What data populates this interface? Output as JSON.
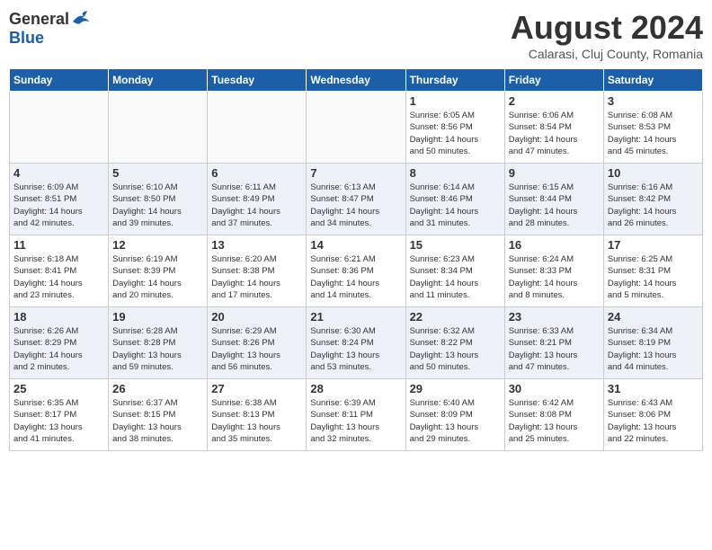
{
  "header": {
    "logo_general": "General",
    "logo_blue": "Blue",
    "month_title": "August 2024",
    "location": "Calarasi, Cluj County, Romania"
  },
  "weekdays": [
    "Sunday",
    "Monday",
    "Tuesday",
    "Wednesday",
    "Thursday",
    "Friday",
    "Saturday"
  ],
  "weeks": [
    [
      {
        "day": "",
        "info": ""
      },
      {
        "day": "",
        "info": ""
      },
      {
        "day": "",
        "info": ""
      },
      {
        "day": "",
        "info": ""
      },
      {
        "day": "1",
        "info": "Sunrise: 6:05 AM\nSunset: 8:56 PM\nDaylight: 14 hours\nand 50 minutes."
      },
      {
        "day": "2",
        "info": "Sunrise: 6:06 AM\nSunset: 8:54 PM\nDaylight: 14 hours\nand 47 minutes."
      },
      {
        "day": "3",
        "info": "Sunrise: 6:08 AM\nSunset: 8:53 PM\nDaylight: 14 hours\nand 45 minutes."
      }
    ],
    [
      {
        "day": "4",
        "info": "Sunrise: 6:09 AM\nSunset: 8:51 PM\nDaylight: 14 hours\nand 42 minutes."
      },
      {
        "day": "5",
        "info": "Sunrise: 6:10 AM\nSunset: 8:50 PM\nDaylight: 14 hours\nand 39 minutes."
      },
      {
        "day": "6",
        "info": "Sunrise: 6:11 AM\nSunset: 8:49 PM\nDaylight: 14 hours\nand 37 minutes."
      },
      {
        "day": "7",
        "info": "Sunrise: 6:13 AM\nSunset: 8:47 PM\nDaylight: 14 hours\nand 34 minutes."
      },
      {
        "day": "8",
        "info": "Sunrise: 6:14 AM\nSunset: 8:46 PM\nDaylight: 14 hours\nand 31 minutes."
      },
      {
        "day": "9",
        "info": "Sunrise: 6:15 AM\nSunset: 8:44 PM\nDaylight: 14 hours\nand 28 minutes."
      },
      {
        "day": "10",
        "info": "Sunrise: 6:16 AM\nSunset: 8:42 PM\nDaylight: 14 hours\nand 26 minutes."
      }
    ],
    [
      {
        "day": "11",
        "info": "Sunrise: 6:18 AM\nSunset: 8:41 PM\nDaylight: 14 hours\nand 23 minutes."
      },
      {
        "day": "12",
        "info": "Sunrise: 6:19 AM\nSunset: 8:39 PM\nDaylight: 14 hours\nand 20 minutes."
      },
      {
        "day": "13",
        "info": "Sunrise: 6:20 AM\nSunset: 8:38 PM\nDaylight: 14 hours\nand 17 minutes."
      },
      {
        "day": "14",
        "info": "Sunrise: 6:21 AM\nSunset: 8:36 PM\nDaylight: 14 hours\nand 14 minutes."
      },
      {
        "day": "15",
        "info": "Sunrise: 6:23 AM\nSunset: 8:34 PM\nDaylight: 14 hours\nand 11 minutes."
      },
      {
        "day": "16",
        "info": "Sunrise: 6:24 AM\nSunset: 8:33 PM\nDaylight: 14 hours\nand 8 minutes."
      },
      {
        "day": "17",
        "info": "Sunrise: 6:25 AM\nSunset: 8:31 PM\nDaylight: 14 hours\nand 5 minutes."
      }
    ],
    [
      {
        "day": "18",
        "info": "Sunrise: 6:26 AM\nSunset: 8:29 PM\nDaylight: 14 hours\nand 2 minutes."
      },
      {
        "day": "19",
        "info": "Sunrise: 6:28 AM\nSunset: 8:28 PM\nDaylight: 13 hours\nand 59 minutes."
      },
      {
        "day": "20",
        "info": "Sunrise: 6:29 AM\nSunset: 8:26 PM\nDaylight: 13 hours\nand 56 minutes."
      },
      {
        "day": "21",
        "info": "Sunrise: 6:30 AM\nSunset: 8:24 PM\nDaylight: 13 hours\nand 53 minutes."
      },
      {
        "day": "22",
        "info": "Sunrise: 6:32 AM\nSunset: 8:22 PM\nDaylight: 13 hours\nand 50 minutes."
      },
      {
        "day": "23",
        "info": "Sunrise: 6:33 AM\nSunset: 8:21 PM\nDaylight: 13 hours\nand 47 minutes."
      },
      {
        "day": "24",
        "info": "Sunrise: 6:34 AM\nSunset: 8:19 PM\nDaylight: 13 hours\nand 44 minutes."
      }
    ],
    [
      {
        "day": "25",
        "info": "Sunrise: 6:35 AM\nSunset: 8:17 PM\nDaylight: 13 hours\nand 41 minutes."
      },
      {
        "day": "26",
        "info": "Sunrise: 6:37 AM\nSunset: 8:15 PM\nDaylight: 13 hours\nand 38 minutes."
      },
      {
        "day": "27",
        "info": "Sunrise: 6:38 AM\nSunset: 8:13 PM\nDaylight: 13 hours\nand 35 minutes."
      },
      {
        "day": "28",
        "info": "Sunrise: 6:39 AM\nSunset: 8:11 PM\nDaylight: 13 hours\nand 32 minutes."
      },
      {
        "day": "29",
        "info": "Sunrise: 6:40 AM\nSunset: 8:09 PM\nDaylight: 13 hours\nand 29 minutes."
      },
      {
        "day": "30",
        "info": "Sunrise: 6:42 AM\nSunset: 8:08 PM\nDaylight: 13 hours\nand 25 minutes."
      },
      {
        "day": "31",
        "info": "Sunrise: 6:43 AM\nSunset: 8:06 PM\nDaylight: 13 hours\nand 22 minutes."
      }
    ]
  ]
}
